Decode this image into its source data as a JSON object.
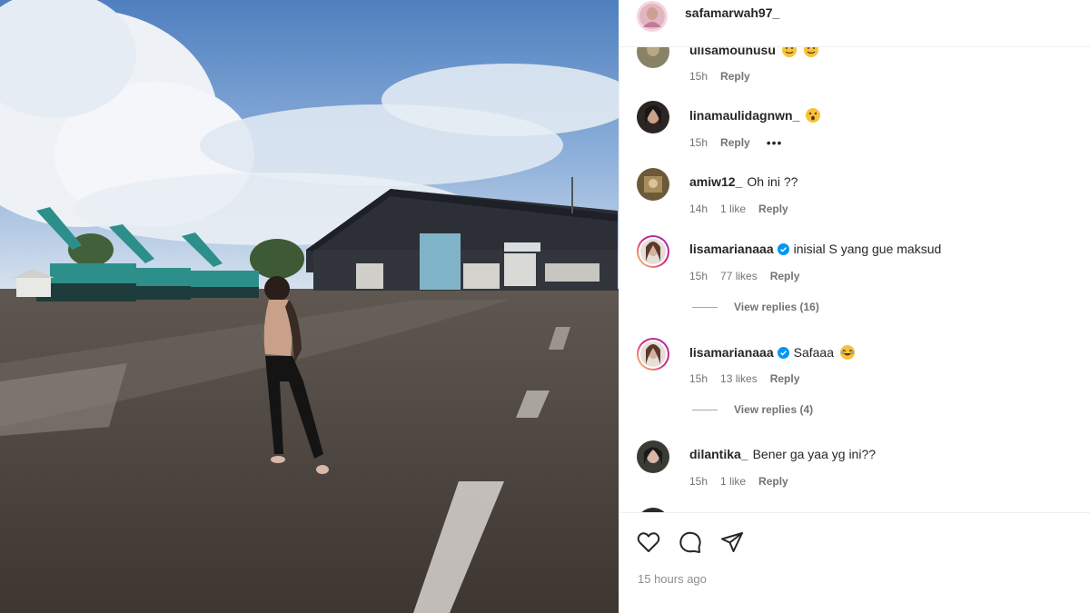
{
  "header": {
    "username": "safamarwah97_"
  },
  "comments": [
    {
      "username": "ulisamounusu",
      "text": "",
      "emoji": [
        "smile-emoji",
        "smile-emoji"
      ],
      "time": "15h",
      "likes": "",
      "reply_label": "Reply",
      "more": false,
      "verified": false,
      "avatar_color": "#8a8266"
    },
    {
      "username": "linamaulidagnwn_",
      "text": "",
      "emoji": [
        "astonished-emoji"
      ],
      "time": "15h",
      "likes": "",
      "reply_label": "Reply",
      "more": true,
      "verified": false,
      "avatar_color": "#2b2624"
    },
    {
      "username": "amiw12_",
      "text": "Oh ini ??",
      "emoji": [],
      "time": "14h",
      "likes": "1 like",
      "reply_label": "Reply",
      "more": false,
      "verified": false,
      "avatar_color": "#6a5a3a"
    },
    {
      "username": "lisamarianaaa",
      "text": "inisial S yang gue maksud",
      "emoji": [],
      "time": "15h",
      "likes": "77 likes",
      "reply_label": "Reply",
      "more": false,
      "verified": true,
      "avatar_color": "#c8a898",
      "story_ring": true
    },
    {
      "username": "lisamarianaaa",
      "text": "Safaaa",
      "emoji": [
        "laughing-emoji"
      ],
      "time": "15h",
      "likes": "13 likes",
      "reply_label": "Reply",
      "more": false,
      "verified": true,
      "avatar_color": "#c8a898",
      "story_ring": true
    },
    {
      "username": "dilantika_",
      "text": "Bener ga yaa yg ini??",
      "emoji": [],
      "time": "15h",
      "likes": "1 like",
      "reply_label": "Reply",
      "more": false,
      "verified": false,
      "avatar_color": "#3b3b36"
    }
  ],
  "view_replies": [
    {
      "label": "View replies (16)"
    },
    {
      "label": "View replies (4)"
    }
  ],
  "actions": {
    "icons": [
      "heart-icon",
      "comment-icon",
      "share-icon"
    ]
  },
  "timestamp": "15 hours ago",
  "colors": {
    "verified": "#0095f6",
    "meta_text": "#737373",
    "story_gradient": [
      "#feda75",
      "#d62976",
      "#962fbf"
    ]
  }
}
